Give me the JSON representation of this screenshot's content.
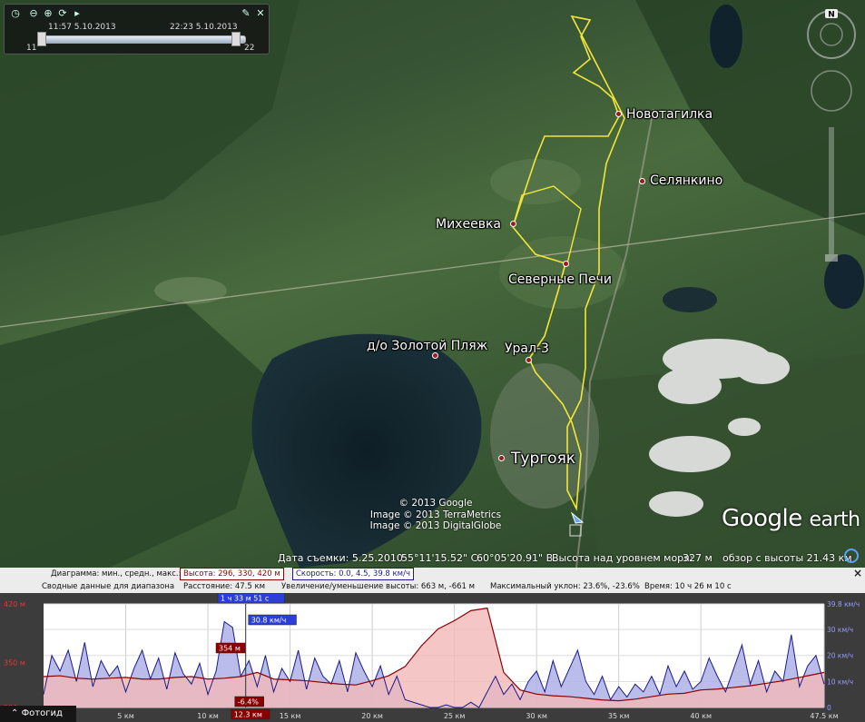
{
  "time_slider": {
    "start_label": "11:57 5.10.2013",
    "end_label": "22:23 5.10.2013",
    "min_value": "11",
    "max_value": "22",
    "icons": [
      "clock-icon",
      "zoom-out-icon",
      "zoom-in-icon",
      "settings-icon",
      "play-icon",
      "wrench-icon",
      "close-icon"
    ]
  },
  "places": [
    {
      "name": "Новотагилка",
      "big": false
    },
    {
      "name": "Селянкино",
      "big": false
    },
    {
      "name": "Михеевка",
      "big": false
    },
    {
      "name": "Северные Печи",
      "big": false
    },
    {
      "name": "д/о Золотой Пляж",
      "big": false
    },
    {
      "name": "Урал-3",
      "big": false
    },
    {
      "name": "Тургояк",
      "big": true
    }
  ],
  "credits": [
    "© 2013 Google",
    "Image © 2013 TerraMetrics",
    "Image © 2013 DigitalGlobe"
  ],
  "logo": {
    "google": "Google",
    "earth": "earth"
  },
  "compass_label": "N",
  "status": {
    "date": "Дата съемки: 5.25.2010",
    "lat": "55°11'15.52\" С",
    "lon": "60°05'20.91\" В",
    "elev_label": "Высота над уровнем моря:",
    "elev_value": "327 м",
    "eye": "обзор с высоты  21.43 км"
  },
  "profile": {
    "row1_label": "Диаграмма: мин., средн., макс.:",
    "height_box": "Высота: 296, 330, 420 м",
    "speed_box": "Скорость: 0.0, 4.5, 39.8 км/ч",
    "row2_label": "Сводные данные для диапазона",
    "distance": "Расстояние: 47.5 км",
    "gain": "Увеличение/уменьшение высоты: 663 м, -661 м",
    "slope": "Максимальный уклон: 23.6%, -23.6%",
    "time": "Время: 10 ч 26 м 10 с",
    "close_label": "×",
    "cursor_time": "1 ч 33 м 51 с",
    "cursor_speed": "30.8 км/ч",
    "cursor_height": "354 м",
    "cursor_slope": "-6.4%",
    "cursor_distance": "12.3 км",
    "cursor_km": 12.3,
    "photo_button": "Фотогид",
    "photo_icon": "chevron-up-icon"
  },
  "chart_data": {
    "type": "area",
    "x_ticks": [
      "5 км",
      "10 км",
      "15 км",
      "20 км",
      "25 км",
      "30 км",
      "35 км",
      "40 км",
      "47.5 км"
    ],
    "x_tick_values": [
      5,
      10,
      15,
      20,
      25,
      30,
      35,
      40,
      47.5
    ],
    "y_left_ticks": [
      "420 м",
      "350 м",
      "296 м"
    ],
    "y_left_tick_values": [
      420,
      350,
      296
    ],
    "y_right_ticks": [
      "39.8 км/ч",
      "30 км/ч",
      "20 км/ч",
      "10 км/ч",
      "0"
    ],
    "y_right_tick_values": [
      39.8,
      30,
      20,
      10,
      0
    ],
    "xlim": [
      0,
      47.5
    ],
    "ylim_left": [
      296,
      420
    ],
    "ylim_right": [
      0,
      39.8
    ],
    "colors": {
      "elevation_line": "#8b0000",
      "elevation_fill": "#f2b8b8",
      "speed_line": "#1a1a8c",
      "speed_fill": "#aeb0e6"
    },
    "series": [
      {
        "x": [
          0,
          1,
          2,
          3,
          4,
          5,
          6,
          7,
          8,
          9,
          10,
          11,
          12,
          13,
          14,
          15,
          16,
          17,
          18,
          19,
          20,
          21,
          22,
          23,
          24,
          25,
          26,
          27,
          28,
          29,
          30,
          31,
          32,
          33,
          34,
          35,
          36,
          37,
          38,
          39,
          40,
          41,
          42,
          43,
          44,
          45,
          46,
          47,
          47.5
        ],
        "values": [
          333,
          334,
          331,
          330,
          331,
          332,
          330,
          330,
          332,
          333,
          330,
          331,
          333,
          338,
          330,
          329,
          328,
          326,
          324,
          323,
          328,
          334,
          345,
          370,
          390,
          400,
          412,
          415,
          338,
          317,
          312,
          310,
          309,
          307,
          305,
          304,
          306,
          309,
          312,
          313,
          317,
          318,
          320,
          322,
          325,
          328,
          332,
          336,
          338
        ]
      },
      {
        "x": [
          0,
          0.5,
          1,
          1.5,
          2,
          2.5,
          3,
          3.5,
          4,
          4.5,
          5,
          5.5,
          6,
          6.5,
          7,
          7.5,
          8,
          8.5,
          9,
          9.5,
          10,
          10.5,
          11,
          11.5,
          12,
          12.5,
          13,
          13.5,
          14,
          14.5,
          15,
          15.5,
          16,
          16.5,
          17,
          17.5,
          18,
          18.5,
          19,
          19.5,
          20,
          20.5,
          21,
          21.5,
          22,
          22.5,
          23,
          23.5,
          24,
          24.5,
          25,
          25.5,
          26,
          26.5,
          27,
          27.5,
          28,
          28.5,
          29,
          29.5,
          30,
          30.5,
          31,
          31.5,
          32,
          32.5,
          33,
          33.5,
          34,
          34.5,
          35,
          35.5,
          36,
          36.5,
          37,
          37.5,
          38,
          38.5,
          39,
          39.5,
          40,
          40.5,
          41,
          41.5,
          42,
          42.5,
          43,
          43.5,
          44,
          44.5,
          45,
          45.5,
          46,
          46.5,
          47,
          47.5
        ],
        "values": [
          5,
          20,
          14,
          22,
          10,
          25,
          8,
          18,
          12,
          16,
          6,
          15,
          22,
          11,
          19,
          7,
          21,
          13,
          9,
          17,
          5,
          14,
          33,
          30.8,
          12,
          18,
          8,
          20,
          6,
          15,
          10,
          22,
          7,
          19,
          12,
          9,
          18,
          6,
          21,
          14,
          8,
          16,
          5,
          12,
          3,
          2,
          1,
          0,
          0,
          1,
          0,
          0,
          2,
          0,
          6,
          12,
          5,
          9,
          3,
          10,
          14,
          6,
          18,
          8,
          15,
          22,
          10,
          5,
          12,
          3,
          8,
          4,
          9,
          6,
          12,
          5,
          16,
          8,
          14,
          7,
          10,
          19,
          12,
          6,
          15,
          24,
          9,
          18,
          6,
          14,
          10,
          28,
          8,
          16,
          20,
          9
        ]
      }
    ]
  }
}
